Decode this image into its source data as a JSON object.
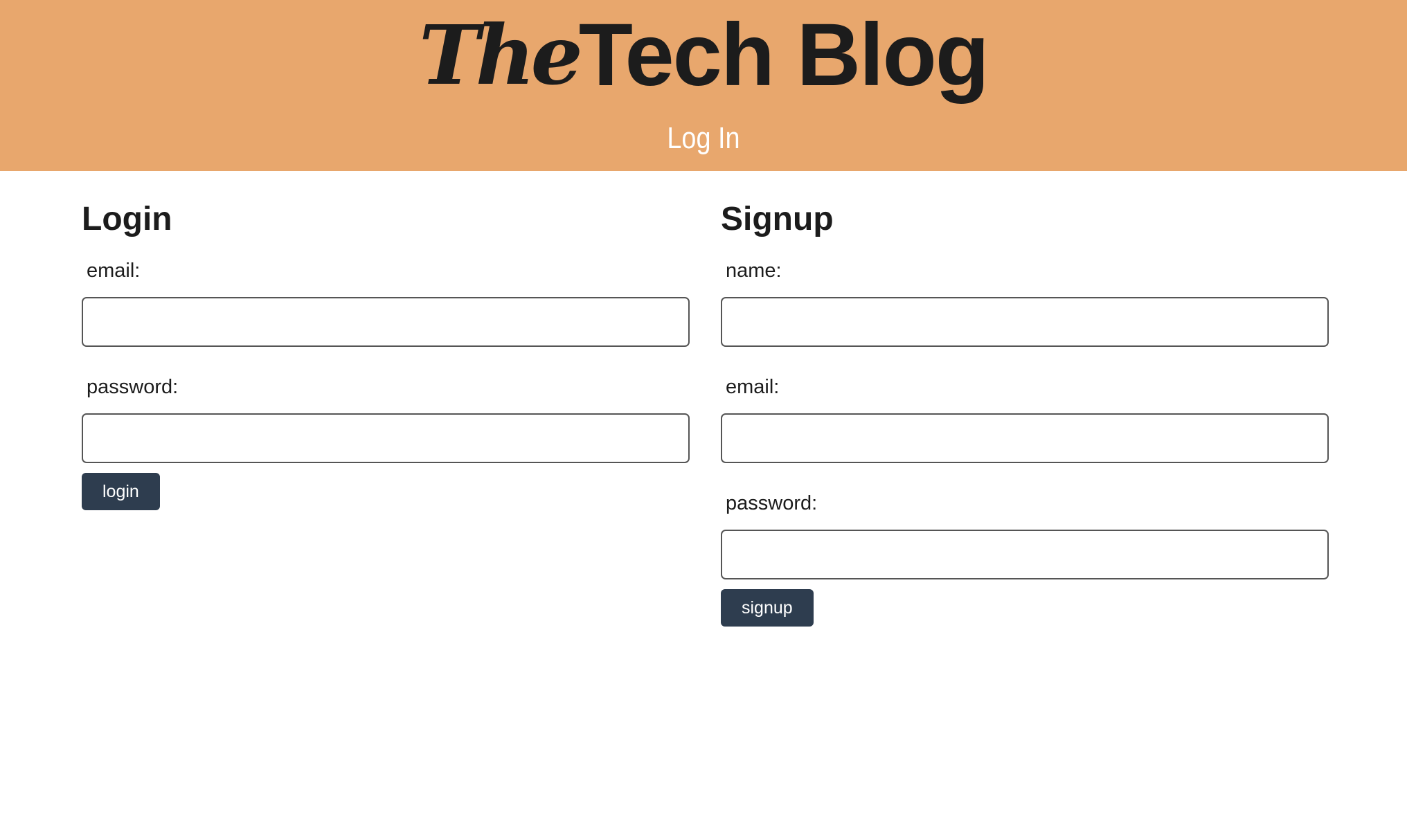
{
  "header": {
    "brand_the": "The",
    "brand_rest": "Tech Blog",
    "subtitle": "Log In"
  },
  "login": {
    "title": "Login",
    "email_label": "email:",
    "password_label": "password:",
    "button_label": "login",
    "email_value": "",
    "password_value": ""
  },
  "signup": {
    "title": "Signup",
    "name_label": "name:",
    "email_label": "email:",
    "password_label": "password:",
    "button_label": "signup",
    "name_value": "",
    "email_value": "",
    "password_value": ""
  },
  "colors": {
    "header_bg": "#e8a76d",
    "button_bg": "#2e3d4f",
    "subtitle_text": "#ffffff"
  }
}
